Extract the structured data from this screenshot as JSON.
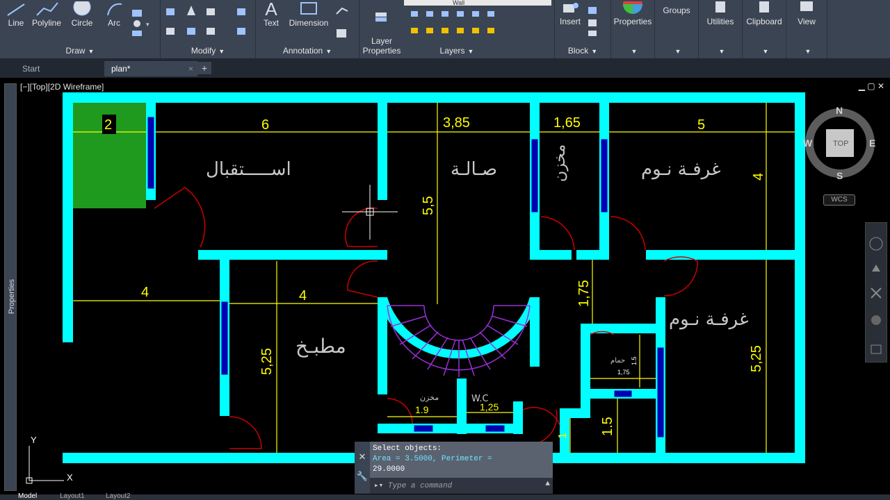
{
  "ribbon": {
    "draw": {
      "title": "Draw",
      "line": "Line",
      "polyline": "Polyline",
      "circle": "Circle",
      "arc": "Arc"
    },
    "modify": {
      "title": "Modify"
    },
    "annotation": {
      "title": "Annotation",
      "text": "Text",
      "dimension": "Dimension"
    },
    "layers": {
      "title": "Layers",
      "layer_properties": "Layer\nProperties",
      "layer_current": "Wall"
    },
    "block": {
      "title": "Block",
      "insert": "Insert"
    },
    "properties": "Properties",
    "groups": "Groups",
    "utilities": "Utilities",
    "clipboard": "Clipboard",
    "view": "View"
  },
  "tabs": [
    {
      "label": "Start"
    },
    {
      "label": "plan*",
      "close": "×"
    }
  ],
  "tab_add": "+",
  "viewport": {
    "label": "[−][Top][2D Wireframe]",
    "controls": "▁ ▢ ✕"
  },
  "side_palette": "Properties",
  "viewcube": {
    "n": "N",
    "s": "S",
    "e": "E",
    "w": "W",
    "top": "TOP",
    "wcs": "WCS"
  },
  "ucs": {
    "x": "X",
    "y": "Y"
  },
  "drawing": {
    "rooms": {
      "reception": "اســـــتقبال",
      "hall": "صـالـة",
      "store_top": "مخزن",
      "bedroom_1": "غرفـة نـوم",
      "bedroom_2": "غرفـة نـوم",
      "kitchen": "مطبـخ",
      "store_bottom": "مخزن",
      "wc": "W.C",
      "bath": "حمام"
    },
    "dims": {
      "d2": "2",
      "d6": "6",
      "d385": "3,85",
      "d165": "1,65",
      "d5": "5",
      "d55": "5,5",
      "d4_right": "4",
      "d4_left": "4",
      "d4_mid": "4",
      "d175": "1,75",
      "d525_left": "5,25",
      "d525_right": "5,25",
      "d19": "1.9",
      "d125": "1,25",
      "d15": "1.5",
      "d1": "1",
      "d175_small": "1,75",
      "d15_small": "1.5"
    }
  },
  "command": {
    "line1": "Select objects:",
    "line2": "Area = 3.5000, Perimeter =",
    "line3": "29.0000",
    "placeholder": "Type a command"
  },
  "status_tabs": [
    "Model",
    "Layout1",
    "Layout2"
  ],
  "colors": {
    "wall": "#00ffff",
    "dim": "#ffff00",
    "door": "#cc0000",
    "stairs": "#9b30d9",
    "hatch": "#1f9a1f",
    "window": "#0000b0",
    "text": "#c8c8c8",
    "ribbon": "#3b4453"
  }
}
